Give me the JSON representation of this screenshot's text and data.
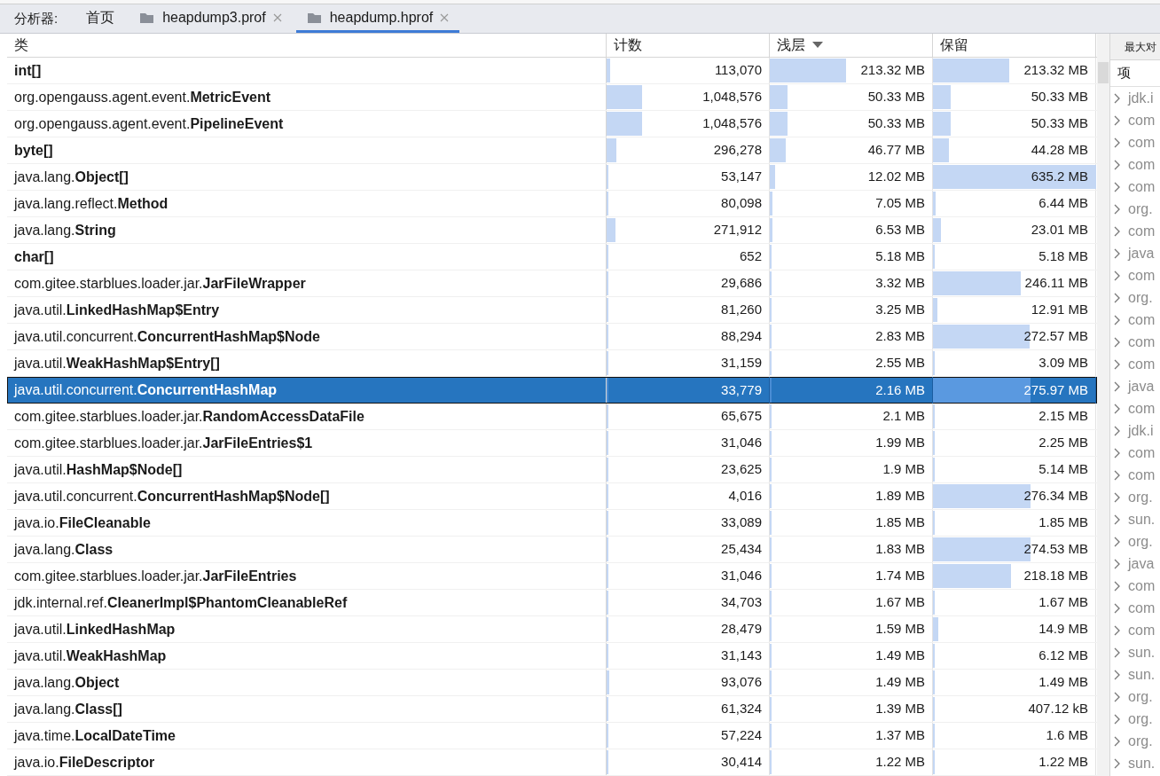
{
  "tabs_bar": {
    "label": "分析器:",
    "tabs": [
      {
        "label": "首页",
        "icon": false,
        "closable": false,
        "selected": false
      },
      {
        "label": "heapdump3.prof",
        "icon": true,
        "closable": true,
        "selected": false
      },
      {
        "label": "heapdump.hprof",
        "icon": true,
        "closable": true,
        "selected": true
      }
    ]
  },
  "table": {
    "columns": [
      {
        "label": "类",
        "sorted": false
      },
      {
        "label": "计数",
        "sorted": false
      },
      {
        "label": "浅层",
        "sorted": true
      },
      {
        "label": "保留",
        "sorted": false
      }
    ],
    "rows": [
      {
        "class": "int[]",
        "bold": true,
        "count": {
          "text": "113,070",
          "level": 0.02
        },
        "shallow": {
          "text": "213.32 MB",
          "level": 0.47
        },
        "retained": {
          "text": "213.32 MB",
          "level": 0.47
        },
        "selected": false
      },
      {
        "class": "org.opengauss.agent.event.**MetricEvent**",
        "bold": false,
        "count": {
          "text": "1,048,576",
          "level": 0.22
        },
        "shallow": {
          "text": "50.33 MB",
          "level": 0.11
        },
        "retained": {
          "text": "50.33 MB",
          "level": 0.11
        },
        "selected": false
      },
      {
        "class": "org.opengauss.agent.event.**PipelineEvent**",
        "bold": false,
        "count": {
          "text": "1,048,576",
          "level": 0.22
        },
        "shallow": {
          "text": "50.33 MB",
          "level": 0.11
        },
        "retained": {
          "text": "50.33 MB",
          "level": 0.11
        },
        "selected": false
      },
      {
        "class": "byte[]",
        "bold": true,
        "count": {
          "text": "296,278",
          "level": 0.06
        },
        "shallow": {
          "text": "46.77 MB",
          "level": 0.1
        },
        "retained": {
          "text": "44.28 MB",
          "level": 0.1
        },
        "selected": false
      },
      {
        "class": "java.lang.**Object[]**",
        "bold": false,
        "count": {
          "text": "53,147",
          "level": 0.01
        },
        "shallow": {
          "text": "12.02 MB",
          "level": 0.03
        },
        "retained": {
          "text": "635.2 MB",
          "level": 1.0
        },
        "selected": false
      },
      {
        "class": "java.lang.reflect.**Method**",
        "bold": false,
        "count": {
          "text": "80,098",
          "level": 0.01
        },
        "shallow": {
          "text": "7.05 MB",
          "level": 0.015
        },
        "retained": {
          "text": "6.44 MB",
          "level": 0.015
        },
        "selected": false
      },
      {
        "class": "java.lang.**String**",
        "bold": false,
        "count": {
          "text": "271,912",
          "level": 0.055
        },
        "shallow": {
          "text": "6.53 MB",
          "level": 0.015
        },
        "retained": {
          "text": "23.01 MB",
          "level": 0.05
        },
        "selected": false
      },
      {
        "class": "char[]",
        "bold": true,
        "count": {
          "text": "652",
          "level": 0.0
        },
        "shallow": {
          "text": "5.18 MB",
          "level": 0.01
        },
        "retained": {
          "text": "5.18 MB",
          "level": 0.01
        },
        "selected": false
      },
      {
        "class": "com.gitee.starblues.loader.jar.**JarFileWrapper**",
        "bold": false,
        "count": {
          "text": "29,686",
          "level": 0.01
        },
        "shallow": {
          "text": "3.32 MB",
          "level": 0.007
        },
        "retained": {
          "text": "246.11 MB",
          "level": 0.54
        },
        "selected": false
      },
      {
        "class": "java.util.**LinkedHashMap$Entry**",
        "bold": false,
        "count": {
          "text": "81,260",
          "level": 0.01
        },
        "shallow": {
          "text": "3.25 MB",
          "level": 0.007
        },
        "retained": {
          "text": "12.91 MB",
          "level": 0.025
        },
        "selected": false
      },
      {
        "class": "java.util.concurrent.**ConcurrentHashMap$Node**",
        "bold": false,
        "count": {
          "text": "88,294",
          "level": 0.01
        },
        "shallow": {
          "text": "2.83 MB",
          "level": 0.006
        },
        "retained": {
          "text": "272.57 MB",
          "level": 0.59
        },
        "selected": false
      },
      {
        "class": "java.util.**WeakHashMap$Entry[]**",
        "bold": false,
        "count": {
          "text": "31,159",
          "level": 0.01
        },
        "shallow": {
          "text": "2.55 MB",
          "level": 0.006
        },
        "retained": {
          "text": "3.09 MB",
          "level": 0.007
        },
        "selected": false
      },
      {
        "class": "java.util.concurrent.**ConcurrentHashMap**",
        "bold": false,
        "count": {
          "text": "33,779",
          "level": 0.01
        },
        "shallow": {
          "text": "2.16 MB",
          "level": 0.005
        },
        "retained": {
          "text": "275.97 MB",
          "level": 0.6
        },
        "selected": true
      },
      {
        "class": "com.gitee.starblues.loader.jar.**RandomAccessDataFile**",
        "bold": false,
        "count": {
          "text": "65,675",
          "level": 0.012
        },
        "shallow": {
          "text": "2.1 MB",
          "level": 0.005
        },
        "retained": {
          "text": "2.15 MB",
          "level": 0.005
        },
        "selected": false
      },
      {
        "class": "com.gitee.starblues.loader.jar.**JarFileEntries$1**",
        "bold": false,
        "count": {
          "text": "31,046",
          "level": 0.006
        },
        "shallow": {
          "text": "1.99 MB",
          "level": 0.005
        },
        "retained": {
          "text": "2.25 MB",
          "level": 0.005
        },
        "selected": false
      },
      {
        "class": "java.util.**HashMap$Node[]**",
        "bold": false,
        "count": {
          "text": "23,625",
          "level": 0.005
        },
        "shallow": {
          "text": "1.9 MB",
          "level": 0.005
        },
        "retained": {
          "text": "5.14 MB",
          "level": 0.01
        },
        "selected": false
      },
      {
        "class": "java.util.concurrent.**ConcurrentHashMap$Node[]**",
        "bold": false,
        "count": {
          "text": "4,016",
          "level": 0.0
        },
        "shallow": {
          "text": "1.89 MB",
          "level": 0.005
        },
        "retained": {
          "text": "276.34 MB",
          "level": 0.6
        },
        "selected": false
      },
      {
        "class": "java.io.**FileCleanable**",
        "bold": false,
        "count": {
          "text": "33,089",
          "level": 0.006
        },
        "shallow": {
          "text": "1.85 MB",
          "level": 0.005
        },
        "retained": {
          "text": "1.85 MB",
          "level": 0.005
        },
        "selected": false
      },
      {
        "class": "java.lang.**Class**",
        "bold": false,
        "count": {
          "text": "25,434",
          "level": 0.005
        },
        "shallow": {
          "text": "1.83 MB",
          "level": 0.005
        },
        "retained": {
          "text": "274.53 MB",
          "level": 0.6
        },
        "selected": false
      },
      {
        "class": "com.gitee.starblues.loader.jar.**JarFileEntries**",
        "bold": false,
        "count": {
          "text": "31,046",
          "level": 0.006
        },
        "shallow": {
          "text": "1.74 MB",
          "level": 0.005
        },
        "retained": {
          "text": "218.18 MB",
          "level": 0.48
        },
        "selected": false
      },
      {
        "class": "jdk.internal.ref.**CleanerImpl$PhantomCleanableRef**",
        "bold": false,
        "count": {
          "text": "34,703",
          "level": 0.006
        },
        "shallow": {
          "text": "1.67 MB",
          "level": 0.005
        },
        "retained": {
          "text": "1.67 MB",
          "level": 0.005
        },
        "selected": false
      },
      {
        "class": "java.util.**LinkedHashMap**",
        "bold": false,
        "count": {
          "text": "28,479",
          "level": 0.005
        },
        "shallow": {
          "text": "1.59 MB",
          "level": 0.005
        },
        "retained": {
          "text": "14.9 MB",
          "level": 0.03
        },
        "selected": false
      },
      {
        "class": "java.util.**WeakHashMap**",
        "bold": false,
        "count": {
          "text": "31,143",
          "level": 0.006
        },
        "shallow": {
          "text": "1.49 MB",
          "level": 0.005
        },
        "retained": {
          "text": "6.12 MB",
          "level": 0.012
        },
        "selected": false
      },
      {
        "class": "java.lang.**Object**",
        "bold": false,
        "count": {
          "text": "93,076",
          "level": 0.018
        },
        "shallow": {
          "text": "1.49 MB",
          "level": 0.005
        },
        "retained": {
          "text": "1.49 MB",
          "level": 0.005
        },
        "selected": false
      },
      {
        "class": "java.lang.**Class[]**",
        "bold": false,
        "count": {
          "text": "61,324",
          "level": 0.012
        },
        "shallow": {
          "text": "1.39 MB",
          "level": 0.005
        },
        "retained": {
          "text": "407.12 kB",
          "level": 0.003
        },
        "selected": false
      },
      {
        "class": "java.time.**LocalDateTime**",
        "bold": false,
        "count": {
          "text": "57,224",
          "level": 0.011
        },
        "shallow": {
          "text": "1.37 MB",
          "level": 0.005
        },
        "retained": {
          "text": "1.6 MB",
          "level": 0.005
        },
        "selected": false
      },
      {
        "class": "java.io.**FileDescriptor**",
        "bold": false,
        "count": {
          "text": "30,414",
          "level": 0.006
        },
        "shallow": {
          "text": "1.22 MB",
          "level": 0.005
        },
        "retained": {
          "text": "1.22 MB",
          "level": 0.005
        },
        "selected": false
      }
    ]
  },
  "side_panel": {
    "title": "最大对",
    "column": "项",
    "items": [
      "jdk.i",
      "com",
      "com",
      "com",
      "com",
      "org.",
      "com",
      "java",
      "com",
      "org.",
      "com",
      "com",
      "com",
      "java",
      "com",
      "jdk.i",
      "com",
      "com",
      "org.",
      "sun.",
      "org.",
      "java",
      "com",
      "com",
      "com",
      "sun.",
      "sun.",
      "org.",
      "org.",
      "org.",
      "sun."
    ]
  }
}
